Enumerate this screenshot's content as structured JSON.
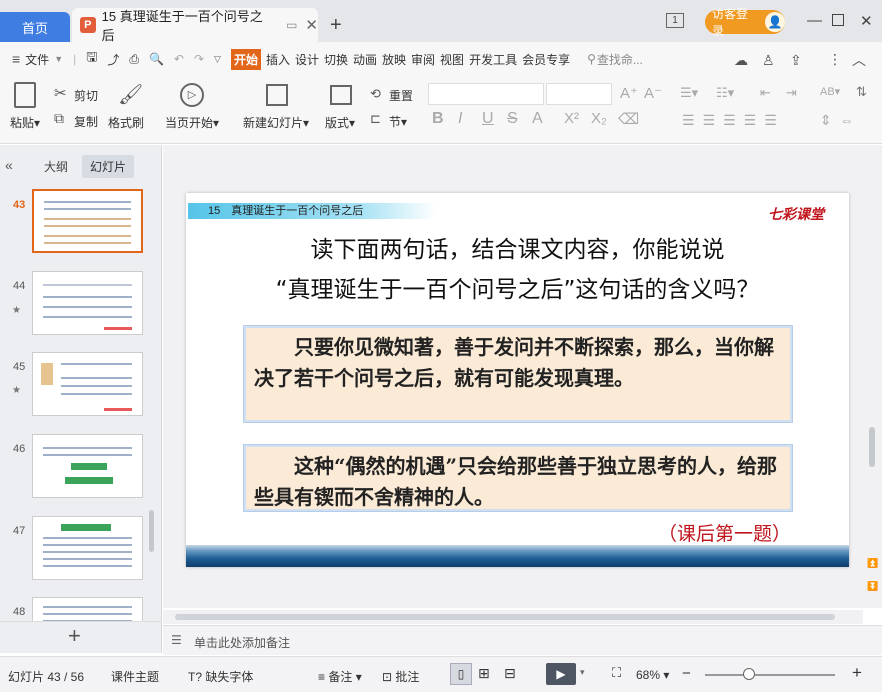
{
  "titlebar": {
    "home_tab": "首页",
    "doc_tab": "15 真理诞生于一百个问号之后",
    "logo_letter": "P",
    "guest_login": "访客登录",
    "page_badge": "1"
  },
  "menu": {
    "file": "文件",
    "items": [
      "开始",
      "插入",
      "设计",
      "切换",
      "动画",
      "放映",
      "审阅",
      "视图",
      "开发工具",
      "会员专享"
    ],
    "search_placeholder": "查找命..."
  },
  "ribbon": {
    "paste": "粘贴",
    "cut": "剪切",
    "copy": "复制",
    "format_painter": "格式刷",
    "from_current": "当页开始",
    "new_slide": "新建幻灯片",
    "layout": "版式",
    "reset": "重置",
    "section": "节"
  },
  "left_panel": {
    "outline_tab": "大纲",
    "slides_tab": "幻灯片",
    "slide_numbers": [
      "43",
      "44",
      "45",
      "46",
      "47",
      "48"
    ]
  },
  "slide": {
    "header": "15　真理诞生于一百个问号之后",
    "brand": "七彩课堂",
    "question_line1": "读下面两句话，结合课文内容，你能说说",
    "question_line2": "“真理诞生于一百个问号之后”这句话的含义吗？",
    "box1": "　　只要你见微知著，善于发问并不断探索，那么，当你解决了若干个问号之后，就有可能发现真理。",
    "box2": "　　这种“偶然的机遇”只会给那些善于独立思考的人，给那些具有锲而不舍精神的人。",
    "footnote": "（课后第一题）"
  },
  "notes_placeholder": "单击此处添加备注",
  "statusbar": {
    "slide_counter": "幻灯片 43 / 56",
    "theme": "课件主题",
    "missing_font": "缺失字体",
    "notes": "备注",
    "comments": "批注",
    "zoom": "68%"
  },
  "colors": {
    "accent_orange": "#e2661a",
    "home_blue": "#3f7de3",
    "footnote_red": "#c0151c"
  }
}
